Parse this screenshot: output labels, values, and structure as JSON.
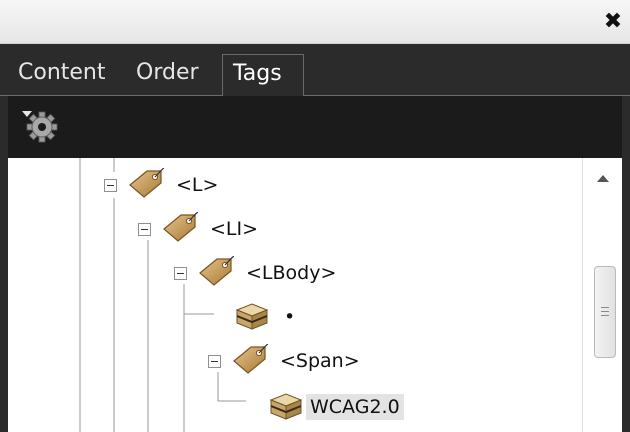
{
  "window": {
    "close_glyph": "✖"
  },
  "tabs": [
    {
      "label": "Content",
      "active": false
    },
    {
      "label": "Order",
      "active": false
    },
    {
      "label": "Tags",
      "active": true
    }
  ],
  "toolbar": {
    "options_icon": "gear-icon",
    "menu_icon": "triangle-down-icon"
  },
  "tree": {
    "nodes": [
      {
        "label": "<L>",
        "icon": "tag-icon",
        "expanded": true
      },
      {
        "label": "<LI>",
        "icon": "tag-icon",
        "expanded": true
      },
      {
        "label": "<LBody>",
        "icon": "tag-icon",
        "expanded": true
      },
      {
        "label": "•",
        "icon": "content-box-icon"
      },
      {
        "label": "<Span>",
        "icon": "tag-icon",
        "expanded": true
      },
      {
        "label": "WCAG2.0",
        "icon": "content-box-icon",
        "selected": true
      }
    ]
  },
  "colors": {
    "titlebar": "#f0f0f0",
    "panel_background": "#2b2b2b",
    "toolbar_background": "#1b1b1b",
    "tree_background": "#ffffff",
    "tag_icon": "#c49a5a",
    "selection": "#e3e3e3"
  }
}
